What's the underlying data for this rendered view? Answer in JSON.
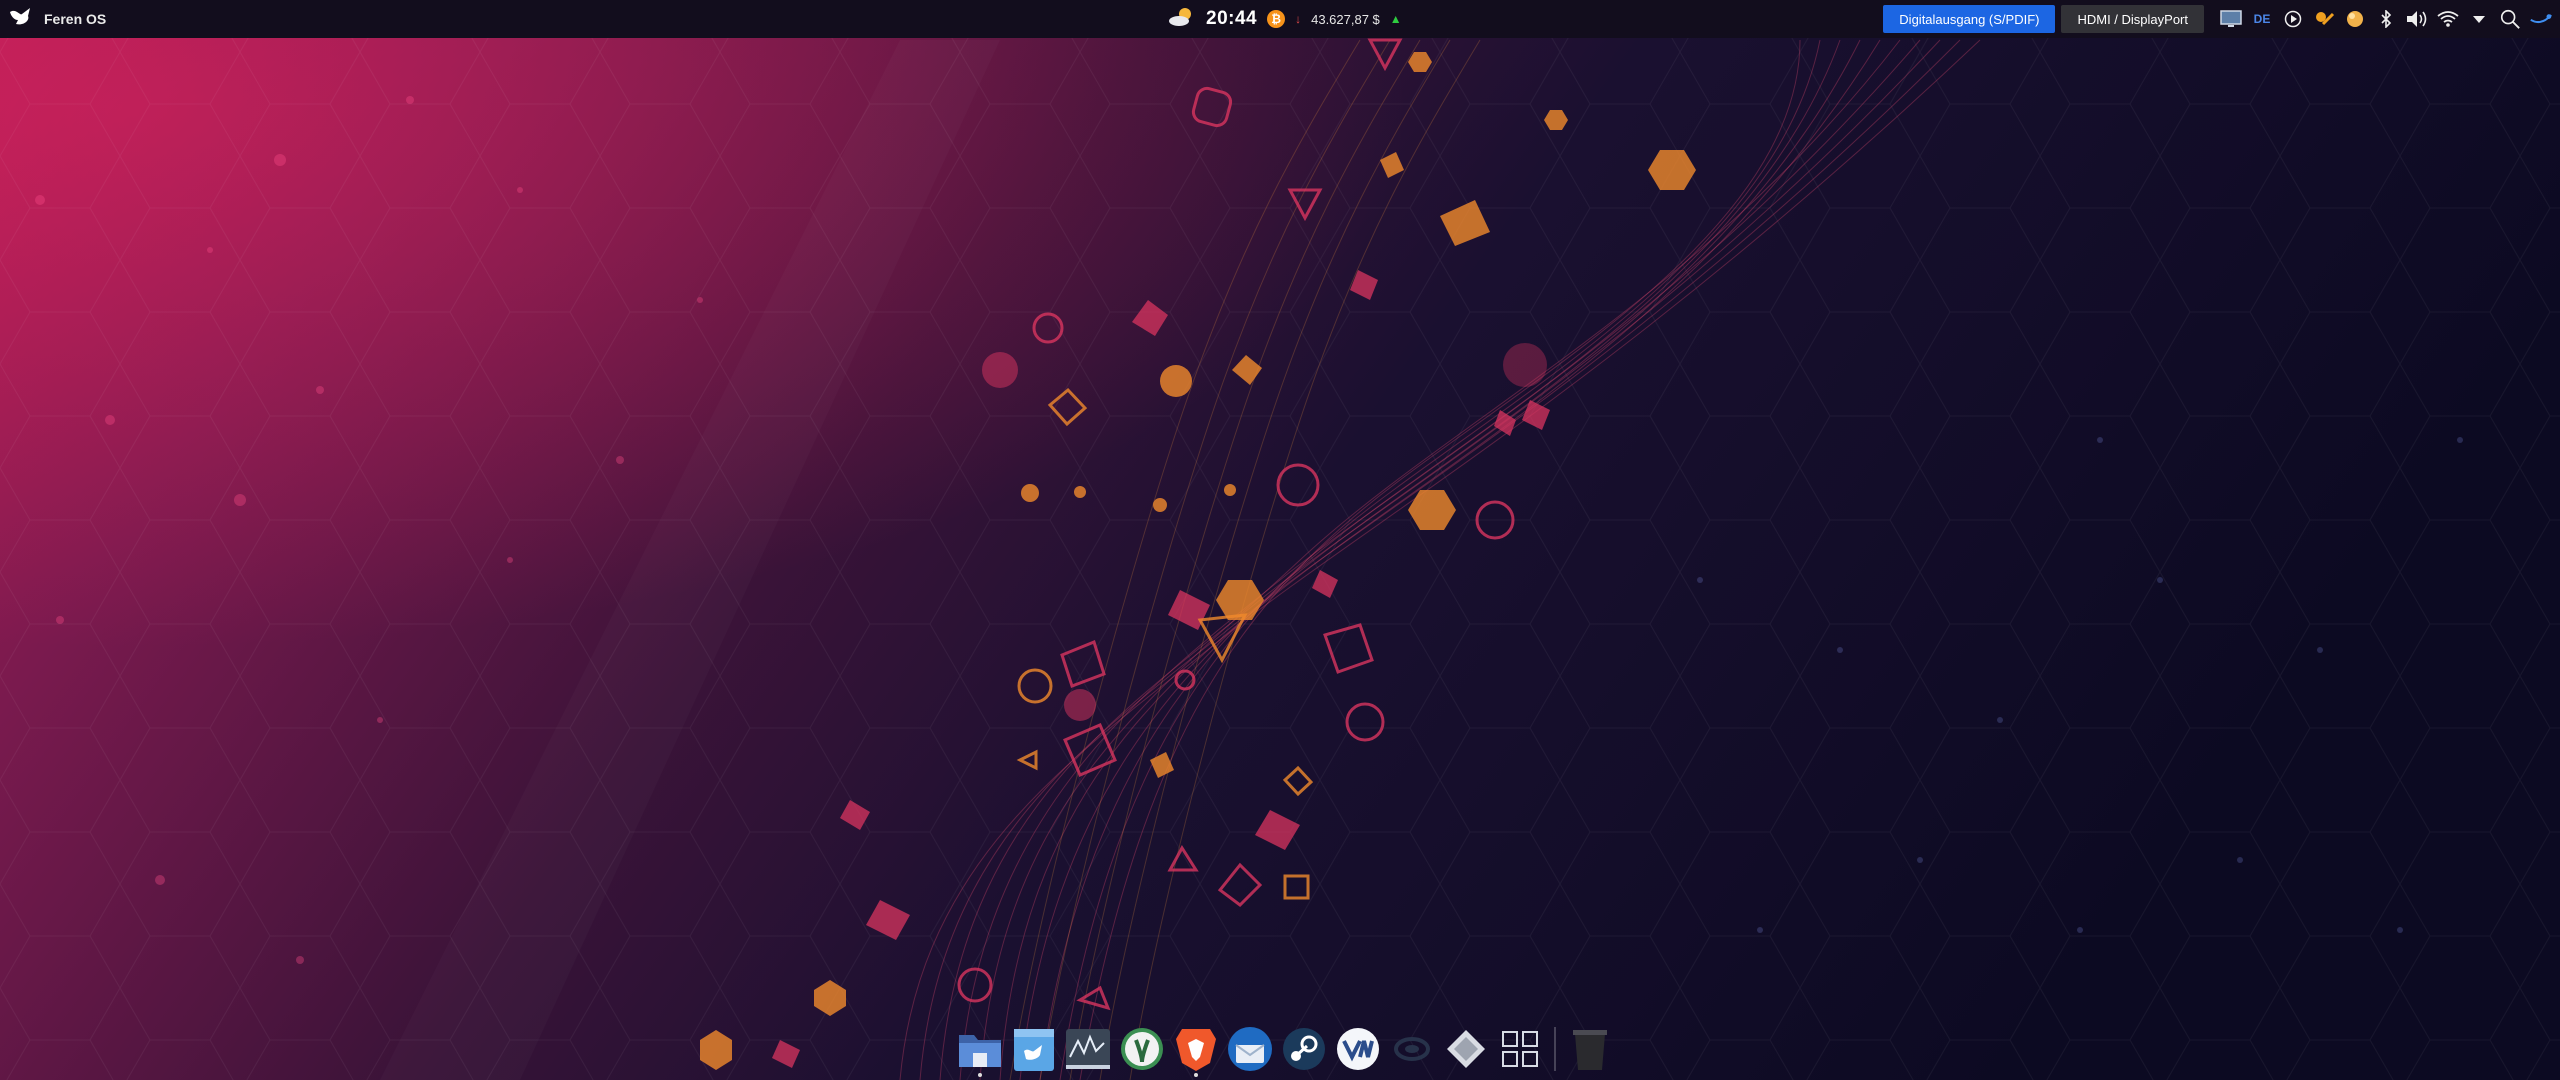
{
  "panel": {
    "os_name": "Feren OS",
    "time": "20:44",
    "crypto": {
      "symbol": "₿",
      "price": "43.627,87 $"
    },
    "audio_outputs": [
      {
        "label": "Digitalausgang (S/PDIF)",
        "active": true
      },
      {
        "label": "HDMI / DisplayPort",
        "active": false
      }
    ],
    "keyboard_layout": "DE",
    "tray_icons": [
      "display-icon",
      "keyboard-layout-indicator",
      "media-play-icon",
      "weather-app-icon",
      "update-orb-icon",
      "bluetooth-icon",
      "volume-icon",
      "wifi-icon",
      "expand-tray-icon",
      "search-icon",
      "feren-menu-icon"
    ]
  },
  "dock": {
    "items": [
      {
        "name": "file-manager-icon"
      },
      {
        "name": "feren-store-icon"
      },
      {
        "name": "system-monitor-icon"
      },
      {
        "name": "terminal-app-icon"
      },
      {
        "name": "brave-browser-icon"
      },
      {
        "name": "thunderbird-mail-icon"
      },
      {
        "name": "steam-icon"
      },
      {
        "name": "vmware-icon"
      },
      {
        "name": "app-launcher-icon"
      },
      {
        "name": "inkscape-icon"
      },
      {
        "name": "show-apps-grid-icon"
      },
      {
        "name": "trash-icon"
      }
    ]
  },
  "colors": {
    "panel_bg": "#120d1d",
    "accent_blue": "#1c66e3",
    "wallpaper_left": "#a51a52",
    "wallpaper_right": "#0d0b22",
    "shape_orange": "#f08a2c",
    "shape_pink": "#d8345f"
  }
}
